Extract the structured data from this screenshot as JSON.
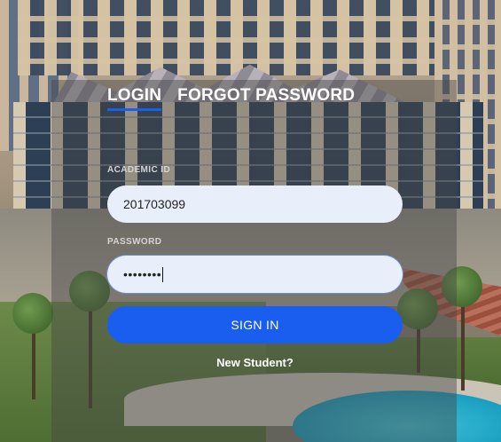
{
  "tabs": [
    {
      "label": "LOGIN",
      "active": true
    },
    {
      "label": "FORGOT PASSWORD",
      "active": false
    }
  ],
  "form": {
    "academic_id": {
      "label": "ACADEMIC ID",
      "value": "201703099"
    },
    "password": {
      "label": "PASSWORD",
      "masked_value": "••••••••"
    },
    "submit_label": "SIGN IN",
    "new_student_link": "New Student?"
  },
  "colors": {
    "accent": "#1a5ef0",
    "field_bg": "#e9eefb",
    "panel_overlay": "rgba(70,70,70,.45)"
  }
}
